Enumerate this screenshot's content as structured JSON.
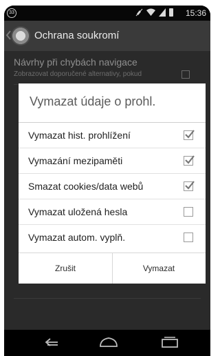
{
  "status_bar": {
    "notification_count": "33",
    "icons": [
      "mute-icon",
      "wifi-icon",
      "signal-icon",
      "battery-icon"
    ],
    "time": "15:36"
  },
  "action_bar": {
    "title": "Ochrana soukromí",
    "icon": "privacy-app-icon"
  },
  "settings_background": {
    "item_title": "Návrhy při chybách navigace",
    "item_summary": "Zobrazovat doporučené alternativy, pokud"
  },
  "dialog": {
    "title": "Vymazat údaje o prohl.",
    "options": [
      {
        "label": "Vymazat hist. prohlížení",
        "checked": true
      },
      {
        "label": "Vymazání mezipaměti",
        "checked": true
      },
      {
        "label": "Smazat cookies/data webů",
        "checked": true
      },
      {
        "label": "Vymazat uložená hesla",
        "checked": false
      },
      {
        "label": "Vymazat autom. vyplň.",
        "checked": false
      }
    ],
    "cancel_label": "Zrušit",
    "confirm_label": "Vymazat"
  },
  "nav_bar": {
    "icons": [
      "back-icon",
      "home-icon",
      "recents-icon"
    ]
  },
  "colors": {
    "dialog_background": "#ffffff",
    "scrim": "#2a2a2a",
    "action_bar": "#3a3a3a",
    "checkmark": "#777777"
  }
}
